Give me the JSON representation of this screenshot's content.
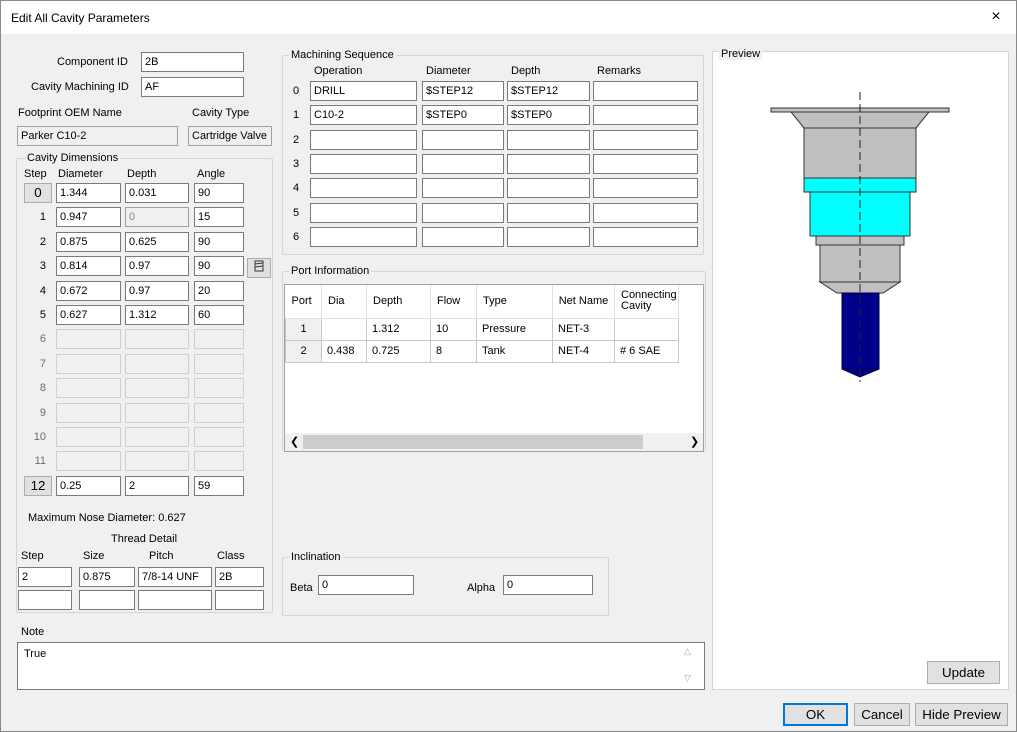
{
  "window": {
    "title": "Edit All Cavity Parameters",
    "close": "×"
  },
  "component_id": {
    "label": "Component ID",
    "value": "2B"
  },
  "cavity_machining_id": {
    "label": "Cavity Machining ID",
    "value": "AF"
  },
  "footprint": {
    "label": "Footprint OEM Name",
    "value": "Parker C10-2"
  },
  "cavity_type": {
    "label": "Cavity Type",
    "value": "Cartridge Valve"
  },
  "cavity_dimensions": {
    "title": "Cavity Dimensions",
    "headers": {
      "step": "Step",
      "diameter": "Diameter",
      "depth": "Depth",
      "angle": "Angle"
    },
    "rows": [
      {
        "step": "0",
        "diameter": "1.344",
        "depth": "0.031",
        "angle": "90"
      },
      {
        "step": "1",
        "diameter": "0.947",
        "depth": "0",
        "angle": "15"
      },
      {
        "step": "2",
        "diameter": "0.875",
        "depth": "0.625",
        "angle": "90"
      },
      {
        "step": "3",
        "diameter": "0.814",
        "depth": "0.97",
        "angle": "90"
      },
      {
        "step": "4",
        "diameter": "0.672",
        "depth": "0.97",
        "angle": "20"
      },
      {
        "step": "5",
        "diameter": "0.627",
        "depth": "1.312",
        "angle": "60"
      },
      {
        "step": "6",
        "diameter": "",
        "depth": "",
        "angle": ""
      },
      {
        "step": "7",
        "diameter": "",
        "depth": "",
        "angle": ""
      },
      {
        "step": "8",
        "diameter": "",
        "depth": "",
        "angle": ""
      },
      {
        "step": "9",
        "diameter": "",
        "depth": "",
        "angle": ""
      },
      {
        "step": "10",
        "diameter": "",
        "depth": "",
        "angle": ""
      },
      {
        "step": "11",
        "diameter": "",
        "depth": "",
        "angle": ""
      },
      {
        "step": "12",
        "diameter": "0.25",
        "depth": "2",
        "angle": "59"
      }
    ],
    "max_nose": "Maximum Nose Diameter: 0.627"
  },
  "thread_detail": {
    "title": "Thread Detail",
    "headers": {
      "step": "Step",
      "size": "Size",
      "pitch": "Pitch",
      "class": "Class"
    },
    "rows": [
      {
        "step": "2",
        "size": "0.875",
        "pitch": "7/8-14 UNF",
        "class": "2B"
      },
      {
        "step": "",
        "size": "",
        "pitch": "",
        "class": ""
      }
    ]
  },
  "machining_sequence": {
    "title": "Machining Sequence",
    "headers": {
      "operation": "Operation",
      "diameter": "Diameter",
      "depth": "Depth",
      "remarks": "Remarks"
    },
    "rows": [
      {
        "num": "0",
        "operation": "DRILL",
        "diameter": "$STEP12",
        "depth": "$STEP12",
        "remarks": ""
      },
      {
        "num": "1",
        "operation": "C10-2",
        "diameter": "$STEP0",
        "depth": "$STEP0",
        "remarks": ""
      },
      {
        "num": "2",
        "operation": "",
        "diameter": "",
        "depth": "",
        "remarks": ""
      },
      {
        "num": "3",
        "operation": "",
        "diameter": "",
        "depth": "",
        "remarks": ""
      },
      {
        "num": "4",
        "operation": "",
        "diameter": "",
        "depth": "",
        "remarks": ""
      },
      {
        "num": "5",
        "operation": "",
        "diameter": "",
        "depth": "",
        "remarks": ""
      },
      {
        "num": "6",
        "operation": "",
        "diameter": "",
        "depth": "",
        "remarks": ""
      }
    ]
  },
  "port_information": {
    "title": "Port Information",
    "headers": {
      "port": "Port",
      "dia": "Dia",
      "depth": "Depth",
      "flow": "Flow",
      "type": "Type",
      "net": "Net Name",
      "conn": "Connecting Cavity"
    },
    "rows": [
      {
        "port": "1",
        "dia": "",
        "depth": "1.312",
        "flow": "10",
        "type": "Pressure",
        "net": "NET-3",
        "conn": ""
      },
      {
        "port": "2",
        "dia": "0.438",
        "depth": "0.725",
        "flow": "8",
        "type": "Tank",
        "net": "NET-4",
        "conn": "# 6 SAE"
      }
    ]
  },
  "inclination": {
    "title": "Inclination",
    "beta_label": "Beta",
    "beta": "0",
    "alpha_label": "Alpha",
    "alpha": "0"
  },
  "note": {
    "title": "Note",
    "value": "True"
  },
  "preview": {
    "title": "Preview",
    "colors": {
      "body": "#c0c0c0",
      "highlight": "#00ffff",
      "drill": "#00008b"
    }
  },
  "buttons": {
    "update": "Update",
    "ok": "OK",
    "cancel": "Cancel",
    "hide_preview": "Hide Preview"
  }
}
